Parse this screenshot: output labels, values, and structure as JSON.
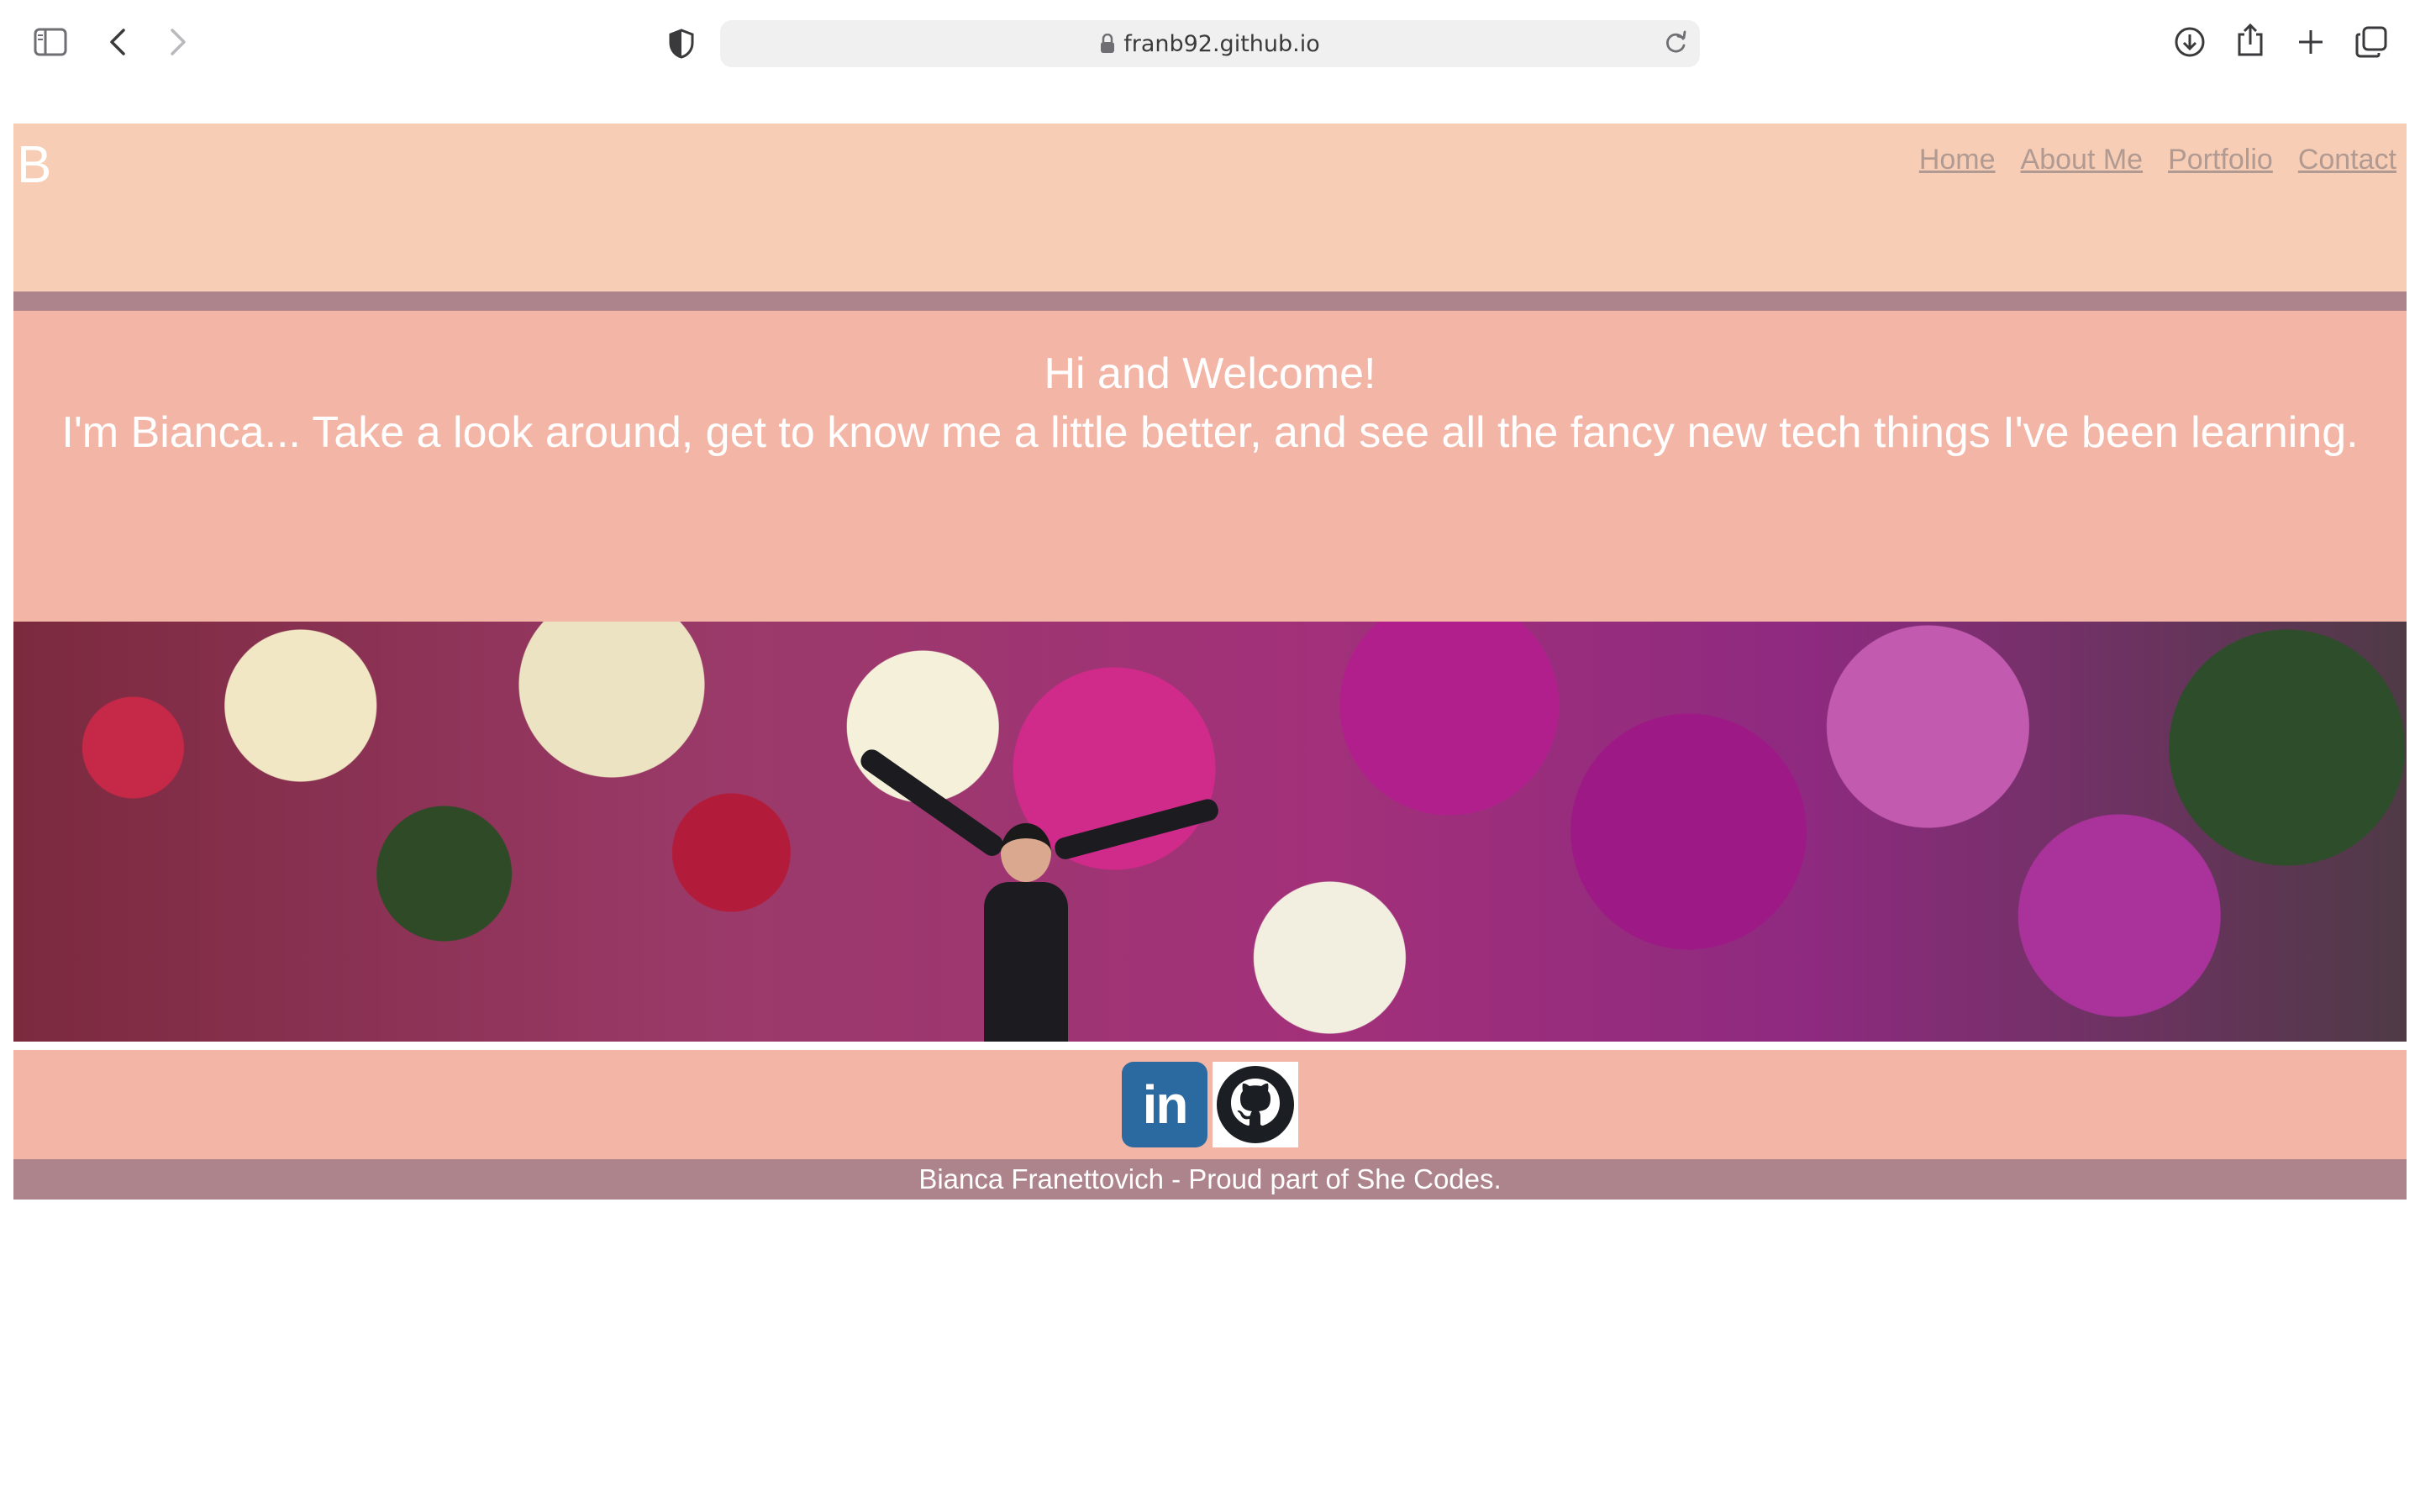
{
  "browser": {
    "url": "franb92.github.io",
    "icons": {
      "sidebar": "sidebar-icon",
      "back": "chevron-left-icon",
      "forward": "chevron-right-icon",
      "privacy": "shield-icon",
      "lock": "lock-icon",
      "reload": "reload-icon",
      "download": "download-icon",
      "share": "share-icon",
      "new_tab": "plus-icon",
      "tabs": "tabs-overview-icon"
    }
  },
  "header": {
    "logo": "B",
    "nav": [
      "Home",
      "About Me",
      "Portfolio",
      "Contact"
    ]
  },
  "hero": {
    "line1": "Hi and Welcome!",
    "line2": "I'm Bianca... Take a look around, get to know me a little better, and see all the fancy new tech things I've been learning."
  },
  "social": {
    "linkedin_label": "in",
    "icons": [
      "linkedin-icon",
      "github-icon"
    ]
  },
  "footer": {
    "text": "Bianca Franettovich - Proud part of She Codes."
  },
  "colors": {
    "header_bg": "#f7cdb5",
    "accent_bar": "#ae848c",
    "hero_bg": "#f3b6a6",
    "nav_link": "#b19a92",
    "linkedin": "#2b6aa0"
  }
}
